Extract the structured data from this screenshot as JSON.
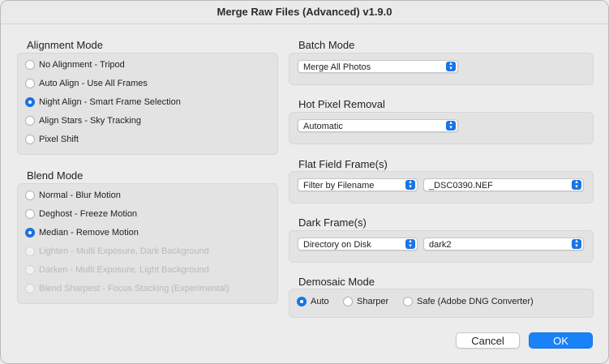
{
  "window": {
    "title": "Merge Raw Files (Advanced) v1.9.0"
  },
  "alignment": {
    "title": "Alignment Mode",
    "options": [
      {
        "label": "No Alignment - Tripod",
        "selected": false,
        "disabled": false
      },
      {
        "label": "Auto Align - Use All Frames",
        "selected": false,
        "disabled": false
      },
      {
        "label": "Night Align - Smart Frame Selection",
        "selected": true,
        "disabled": false
      },
      {
        "label": "Align Stars - Sky Tracking",
        "selected": false,
        "disabled": false
      },
      {
        "label": "Pixel Shift",
        "selected": false,
        "disabled": false
      }
    ]
  },
  "blend": {
    "title": "Blend Mode",
    "options": [
      {
        "label": "Normal - Blur Motion",
        "selected": false,
        "disabled": false
      },
      {
        "label": "Deghost - Freeze Motion",
        "selected": false,
        "disabled": false
      },
      {
        "label": "Median - Remove Motion",
        "selected": true,
        "disabled": false
      },
      {
        "label": "Lighten - Multi Exposure, Dark Background",
        "selected": false,
        "disabled": true
      },
      {
        "label": "Darken - Multi Exposure, Light Background",
        "selected": false,
        "disabled": true
      },
      {
        "label": "Blend Sharpest - Focus Stacking (Experimental)",
        "selected": false,
        "disabled": true
      }
    ]
  },
  "batch": {
    "title": "Batch Mode",
    "value": "Merge All Photos"
  },
  "hot_pixel": {
    "title": "Hot Pixel Removal",
    "value": "Automatic"
  },
  "flat_field": {
    "title": "Flat Field Frame(s)",
    "source": "Filter by Filename",
    "value": "_DSC0390.NEF"
  },
  "dark_frame": {
    "title": "Dark Frame(s)",
    "source": "Directory on Disk",
    "value": "dark2"
  },
  "demosaic": {
    "title": "Demosaic Mode",
    "options": [
      {
        "label": "Auto",
        "selected": true
      },
      {
        "label": "Sharper",
        "selected": false
      },
      {
        "label": "Safe (Adobe DNG Converter)",
        "selected": false
      }
    ]
  },
  "buttons": {
    "cancel": "Cancel",
    "ok": "OK"
  },
  "colors": {
    "accent": "#1a73e8",
    "panel": "#e3e3e3",
    "background": "#ececec"
  }
}
